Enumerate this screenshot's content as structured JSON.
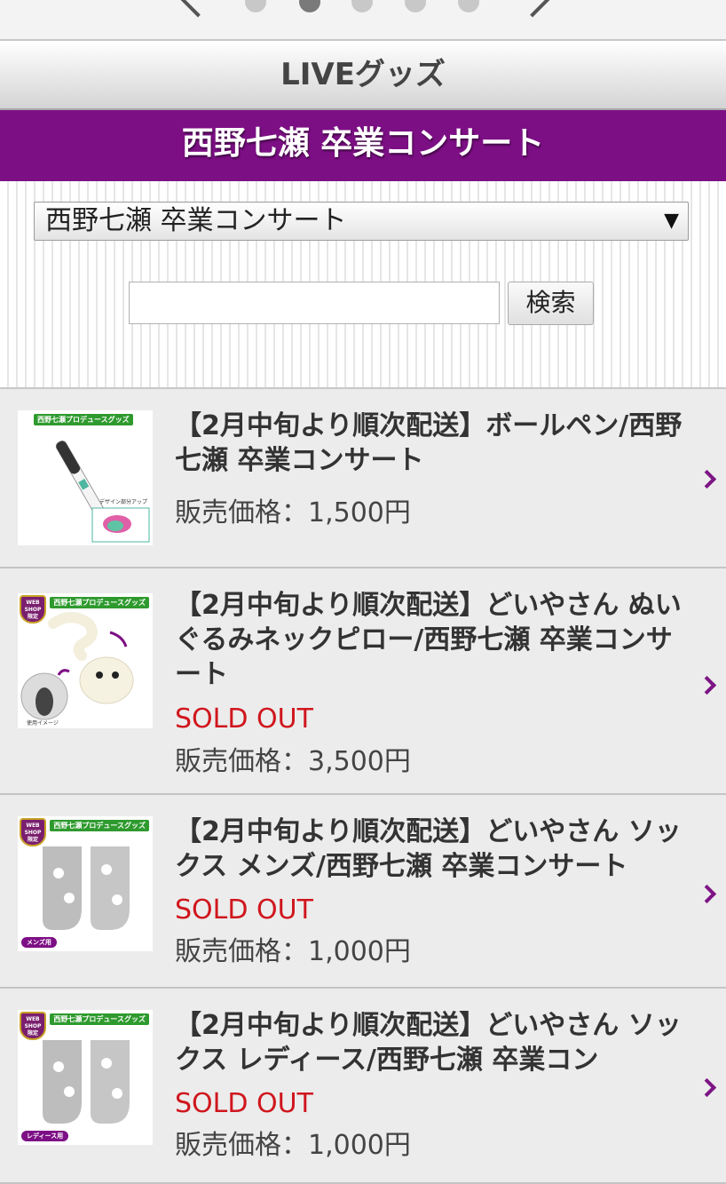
{
  "header": {
    "section_title": "LIVEグッズ",
    "concert_title": "西野七瀬 卒業コンサート"
  },
  "filter": {
    "selected": "西野七瀬 卒業コンサート",
    "select_arrow": "▼",
    "search_placeholder": "",
    "search_button": "検索"
  },
  "products": [
    {
      "title": "【2月中旬より順次配送】ボールペン/西野七瀬 卒業コンサート",
      "status": "",
      "price": "販売価格：1,500円",
      "thumb_tag": "西野七瀬プロデュースグッズ",
      "thumb_note": "デザイン部分アップ"
    },
    {
      "title": "【2月中旬より順次配送】どいやさん ぬいぐるみネックピロー/西野七瀬 卒業コンサート",
      "status": "SOLD OUT",
      "price": "販売価格：3,500円",
      "thumb_tag": "西野七瀬プロデュースグッズ",
      "thumb_badge": "WEB SHOP 限定",
      "thumb_note": "使用イメージ"
    },
    {
      "title": "【2月中旬より順次配送】どいやさん ソックス メンズ/西野七瀬 卒業コンサート",
      "status": "SOLD OUT",
      "price": "販売価格：1,000円",
      "thumb_tag": "西野七瀬プロデュースグッズ",
      "thumb_badge": "WEB SHOP 限定",
      "thumb_bottom_tag": "メンズ用"
    },
    {
      "title": "【2月中旬より順次配送】どいやさん ソックス レディース/西野七瀬 卒業コン",
      "status": "SOLD OUT",
      "price": "販売価格：1,000円",
      "thumb_tag": "西野七瀬プロデュースグッズ",
      "thumb_badge": "WEB SHOP 限定",
      "thumb_bottom_tag": "レディース用"
    }
  ],
  "colors": {
    "accent_purple": "#7d0f85",
    "sold_out_red": "#d0161d"
  }
}
